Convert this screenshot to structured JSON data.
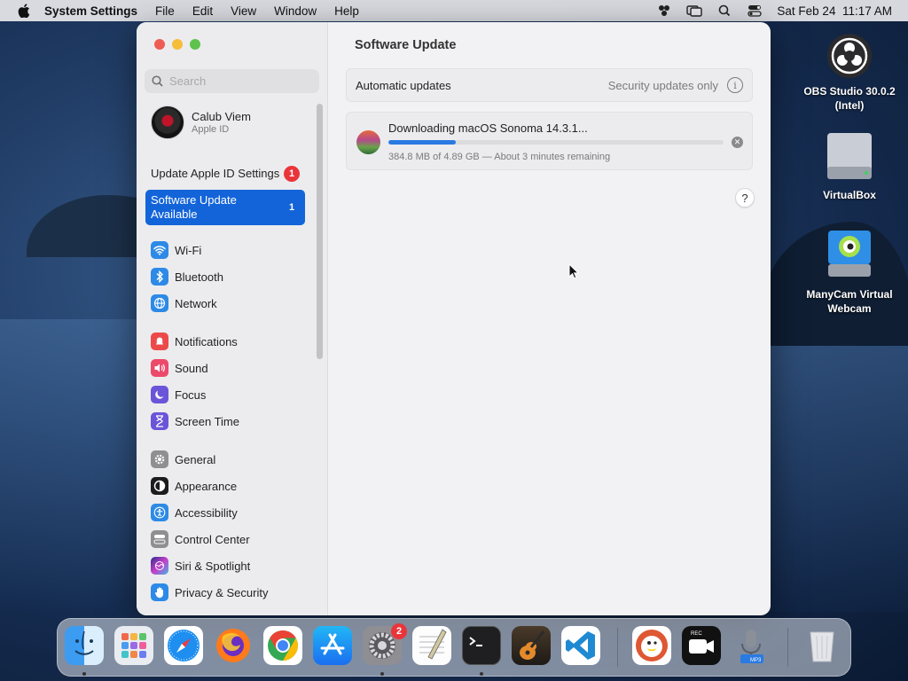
{
  "menubar": {
    "app_name": "System Settings",
    "menus": [
      "File",
      "Edit",
      "View",
      "Window",
      "Help"
    ],
    "datetime": "Sat Feb 24  11:17 AM"
  },
  "sidebar": {
    "search_placeholder": "Search",
    "account": {
      "name": "Calub Viem",
      "subtitle": "Apple ID"
    },
    "notices": [
      {
        "label": "Update Apple ID Settings",
        "badge": "1"
      },
      {
        "label": "Software Update Available",
        "badge": "1"
      }
    ],
    "items": [
      {
        "label": "Wi-Fi",
        "icon": "wifi-icon",
        "color": "#2d8ae6"
      },
      {
        "label": "Bluetooth",
        "icon": "bluetooth-icon",
        "color": "#2d8ae6"
      },
      {
        "label": "Network",
        "icon": "network-globe-icon",
        "color": "#2d8ae6"
      },
      {
        "label": "Notifications",
        "icon": "notifications-icon",
        "color": "#ec4a4a"
      },
      {
        "label": "Sound",
        "icon": "sound-icon",
        "color": "#ec4a6a"
      },
      {
        "label": "Focus",
        "icon": "focus-moon-icon",
        "color": "#6a55d9"
      },
      {
        "label": "Screen Time",
        "icon": "screen-time-icon",
        "color": "#6a55d9"
      },
      {
        "label": "General",
        "icon": "general-gear-icon",
        "color": "#8e8e93"
      },
      {
        "label": "Appearance",
        "icon": "appearance-icon",
        "color": "#1c1c1e"
      },
      {
        "label": "Accessibility",
        "icon": "accessibility-icon",
        "color": "#2d8ae6"
      },
      {
        "label": "Control Center",
        "icon": "control-center-icon",
        "color": "#8e8e93"
      },
      {
        "label": "Siri & Spotlight",
        "icon": "siri-icon",
        "color": "#c63fc9"
      },
      {
        "label": "Privacy & Security",
        "icon": "privacy-hand-icon",
        "color": "#2d8ae6"
      }
    ]
  },
  "main": {
    "title": "Software Update",
    "automatic_updates": {
      "label": "Automatic updates",
      "value": "Security updates only"
    },
    "download": {
      "title": "Downloading macOS Sonoma 14.3.1...",
      "progress_percent": 20,
      "detail": "384.8 MB of 4.89 GB — About 3 minutes remaining"
    },
    "help_label": "?"
  },
  "desktop_icons": [
    {
      "label": "OBS Studio 30.0.2 (Intel)",
      "icon": "obs-icon"
    },
    {
      "label": "VirtualBox",
      "icon": "disk-icon"
    },
    {
      "label": "ManyCam Virtual Webcam",
      "icon": "manycam-icon"
    }
  ],
  "dock": {
    "settings_badge": "2",
    "apps": [
      "Finder",
      "Launchpad",
      "Safari",
      "Firefox",
      "Chrome",
      "App Store",
      "System Settings",
      "TextEdit",
      "Terminal",
      "GarageBand",
      "Visual Studio Code",
      "DuckDuckGo",
      "Screen Recorder",
      "Audio Converter",
      "Trash"
    ]
  }
}
